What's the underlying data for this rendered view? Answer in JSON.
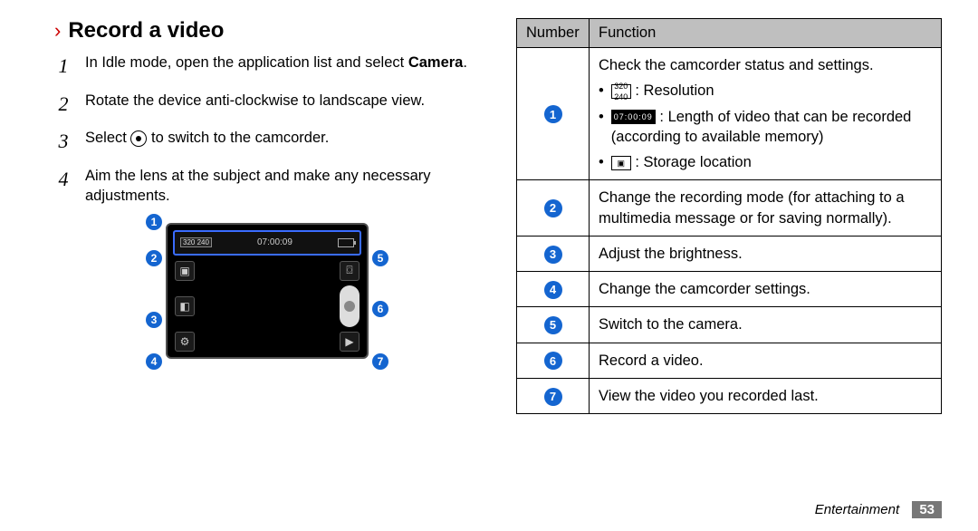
{
  "heading": "Record a video",
  "steps": {
    "s1a": "In Idle mode, open the application list and select ",
    "s1b": "Camera",
    "s1c": ".",
    "s2": "Rotate the device anti-clockwise to landscape view.",
    "s3a": "Select ",
    "s3b": " to switch to the camcorder.",
    "s4": "Aim the lens at the subject and make any necessary adjustments."
  },
  "mock": {
    "resolution_chip": "320\n240",
    "time": "07:00:09"
  },
  "callouts": {
    "c1": "1",
    "c2": "2",
    "c3": "3",
    "c4": "4",
    "c5": "5",
    "c6": "6",
    "c7": "7"
  },
  "table": {
    "hdr_num": "Number",
    "hdr_fn": "Function",
    "row1": {
      "lead": "Check the camcorder status and settings.",
      "b1": " : Resolution",
      "b2": " : Length of video that can be recorded (according to available memory)",
      "b3": " : Storage location"
    },
    "row2": "Change the recording mode (for attaching to a multimedia message or for saving normally).",
    "row3": "Adjust the brightness.",
    "row4": "Change the camcorder settings.",
    "row5": "Switch to the camera.",
    "row6": "Record a video.",
    "row7": "View the video you recorded last."
  },
  "footer": {
    "section": "Entertainment",
    "page": "53"
  }
}
